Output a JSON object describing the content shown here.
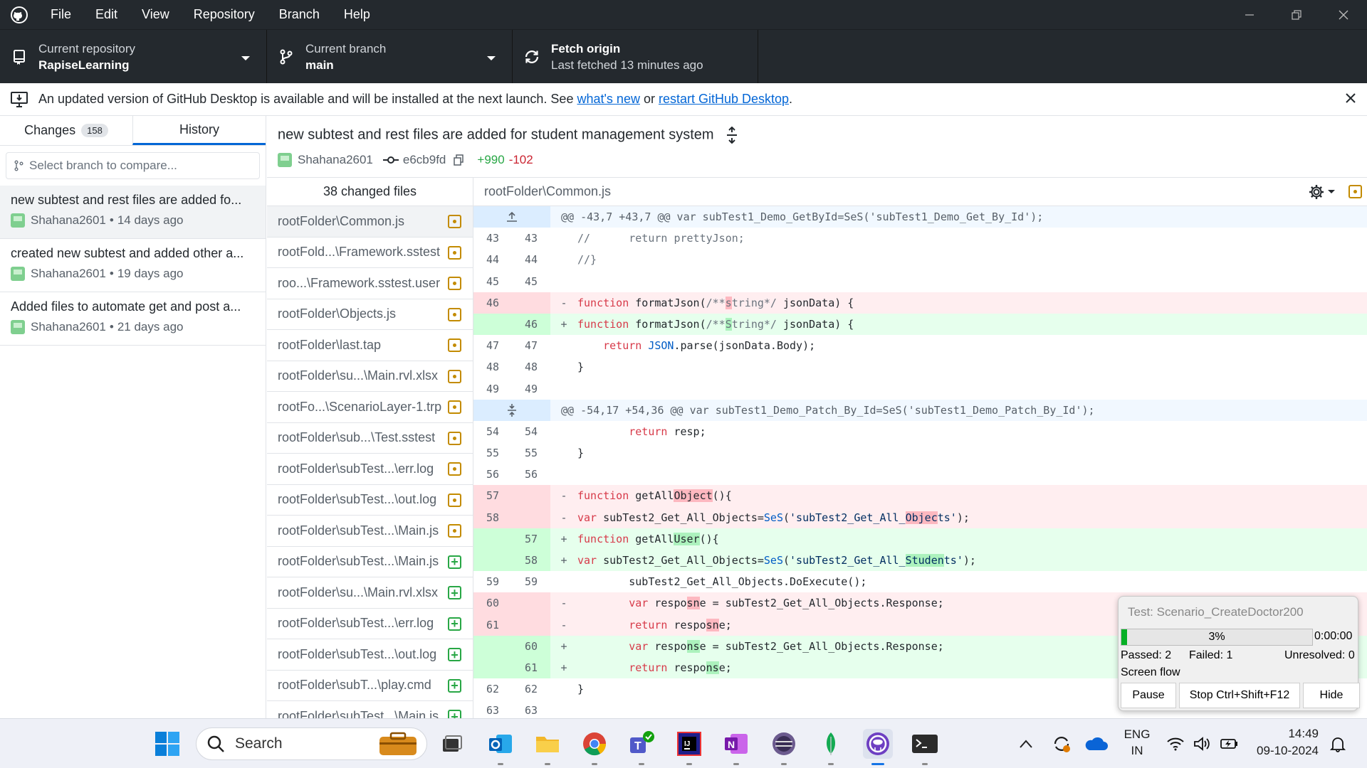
{
  "titlebar": {
    "menu": [
      "File",
      "Edit",
      "View",
      "Repository",
      "Branch",
      "Help"
    ]
  },
  "toolbar": {
    "repo_label": "Current repository",
    "repo_value": "RapiseLearning",
    "branch_label": "Current branch",
    "branch_value": "main",
    "fetch_label": "Fetch origin",
    "fetch_sub": "Last fetched 13 minutes ago"
  },
  "banner": {
    "text": "An updated version of GitHub Desktop is available and will be installed at the next launch. See ",
    "link1": "what's new",
    "mid": " or ",
    "link2": "restart GitHub Desktop",
    "end": "."
  },
  "sidebar": {
    "tab_changes": "Changes",
    "changes_count": "158",
    "tab_history": "History",
    "compare_placeholder": "Select branch to compare...",
    "commits": [
      {
        "message": "new subtest and rest files are added fo...",
        "author": "Shahana2601",
        "time": "14 days ago"
      },
      {
        "message": "created new subtest and added other a...",
        "author": "Shahana2601",
        "time": "19 days ago"
      },
      {
        "message": "Added files to automate get and post a...",
        "author": "Shahana2601",
        "time": "21 days ago"
      }
    ]
  },
  "commit": {
    "title": "new subtest and rest files are added for student management system",
    "author": "Shahana2601",
    "sha": "e6cb9fd",
    "additions": "+990",
    "deletions": "-102"
  },
  "files": {
    "header": "38 changed files",
    "items": [
      {
        "name": "rootFolder\\Common.js",
        "status": "modified"
      },
      {
        "name": "rootFold...\\Framework.sstest",
        "status": "modified"
      },
      {
        "name": "roo...\\Framework.sstest.user",
        "status": "modified"
      },
      {
        "name": "rootFolder\\Objects.js",
        "status": "modified"
      },
      {
        "name": "rootFolder\\last.tap",
        "status": "modified"
      },
      {
        "name": "rootFolder\\su...\\Main.rvl.xlsx",
        "status": "modified"
      },
      {
        "name": "rootFo...\\ScenarioLayer-1.trp",
        "status": "modified"
      },
      {
        "name": "rootFolder\\sub...\\Test.sstest",
        "status": "modified"
      },
      {
        "name": "rootFolder\\subTest...\\err.log",
        "status": "modified"
      },
      {
        "name": "rootFolder\\subTest...\\out.log",
        "status": "modified"
      },
      {
        "name": "rootFolder\\subTest...\\Main.js",
        "status": "modified"
      },
      {
        "name": "rootFolder\\subTest...\\Main.js",
        "status": "added"
      },
      {
        "name": "rootFolder\\su...\\Main.rvl.xlsx",
        "status": "added"
      },
      {
        "name": "rootFolder\\subTest...\\err.log",
        "status": "added"
      },
      {
        "name": "rootFolder\\subTest...\\out.log",
        "status": "added"
      },
      {
        "name": "rootFolder\\subT...\\play.cmd",
        "status": "added"
      },
      {
        "name": "rootFolder\\subTest...\\Main.js",
        "status": "added"
      }
    ]
  },
  "diff": {
    "file": "rootFolder\\Common.js",
    "hunk1": "@@ -43,7 +43,7 @@ var subTest1_Demo_GetById=SeS('subTest1_Demo_Get_By_Id');",
    "hunk2": "@@ -54,17 +54,36 @@ var subTest1_Demo_Patch_By_Id=SeS('subTest1_Demo_Patch_By_Id');",
    "lines": {
      "l43": "//      return prettyJson;",
      "l44": "//}",
      "l47": "    return JSON.parse(jsonData.Body);",
      "l48": "}",
      "l54": "        return resp;",
      "l55": "}",
      "l59": "        subTest2_Get_All_Objects.DoExecute();",
      "l62": "}"
    },
    "nums": {
      "n43": "43",
      "n44": "44",
      "n45": "45",
      "n46": "46",
      "n47": "47",
      "n48": "48",
      "n49": "49",
      "n54": "54",
      "n55": "55",
      "n56": "56",
      "n57": "57",
      "n58": "58",
      "n59": "59",
      "n60": "60",
      "n61": "61",
      "n62": "62",
      "n63": "63"
    }
  },
  "test_popup": {
    "title": "Test: Scenario_CreateDoctor200",
    "progress": 0.03,
    "percent": "3%",
    "time": "0:00:00",
    "passed": "Passed: 2",
    "failed": "Failed: 1",
    "unresolved": "Unresolved: 0",
    "flow": "Screen flow",
    "pause": "Pause",
    "stop": "Stop Ctrl+Shift+F12",
    "hide": "Hide"
  },
  "taskbar": {
    "search": "Search",
    "lang1": "ENG",
    "lang2": "IN",
    "time": "14:49",
    "date": "09-10-2024"
  }
}
